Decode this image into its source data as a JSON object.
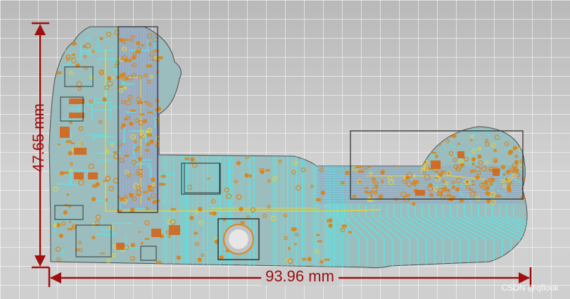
{
  "dimensions": {
    "height_label": "47.65 mm",
    "width_label": "93.96 mm"
  },
  "watermark": "CSDN @qflook",
  "colors": {
    "background": "#c9c9c9",
    "board": "#9bbdbd",
    "trace_cyan": "#5fe3e3",
    "trace_purple": "#8f7ad0",
    "pad_orange": "#d8861f",
    "pad_yellow": "#e6d23a",
    "dimension_red": "#a00f0f",
    "outline": "#2a2a2a"
  },
  "icons": {
    "arrow": "arrowhead",
    "mounting_hole": "circle-in-square"
  }
}
